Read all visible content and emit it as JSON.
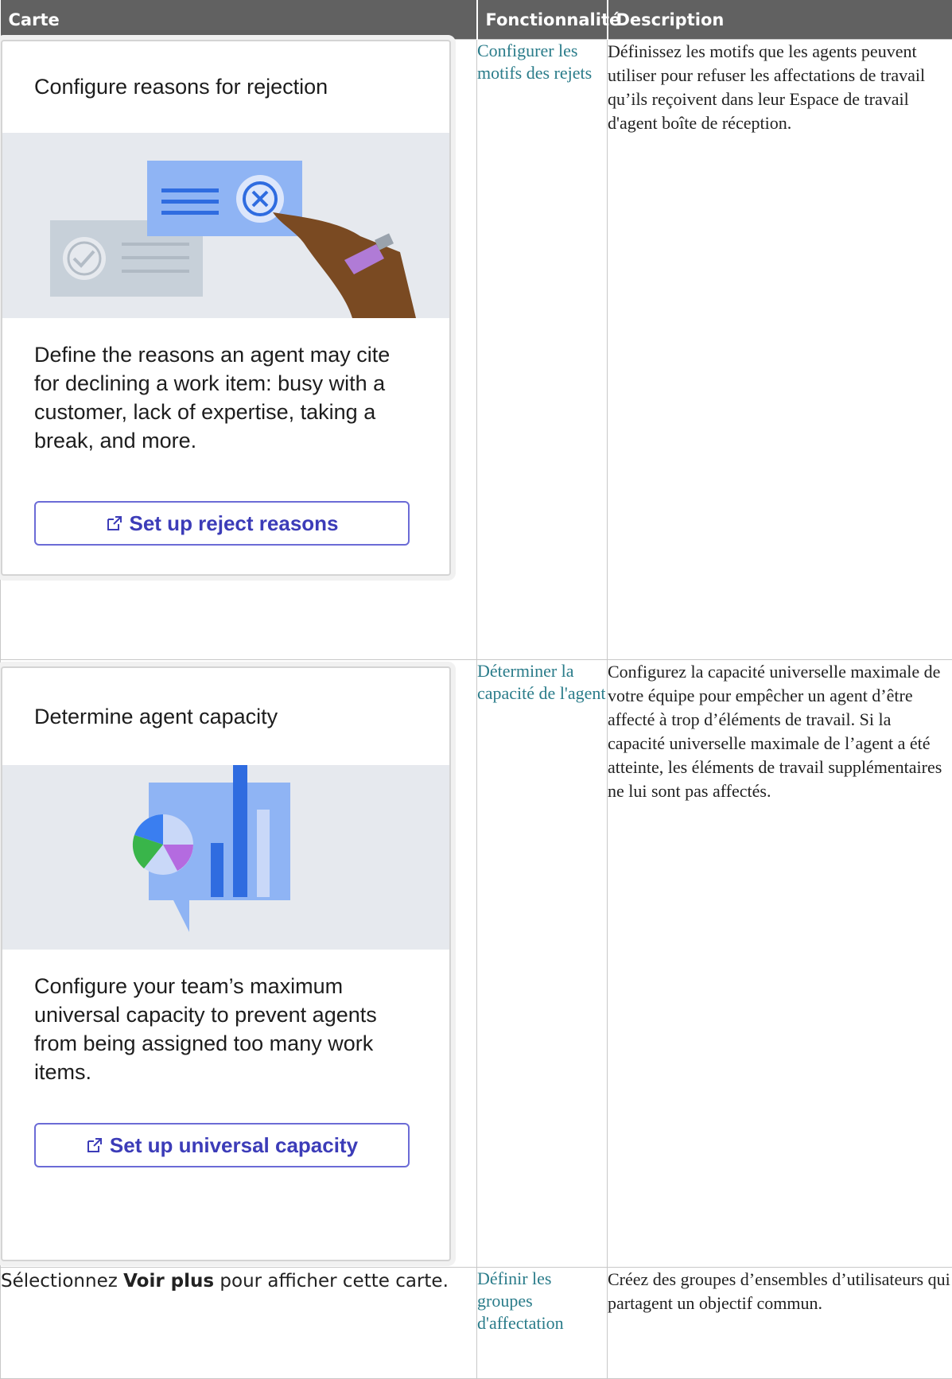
{
  "table": {
    "headers": [
      "Carte",
      "Fonctionnalité",
      "Description"
    ]
  },
  "rows": [
    {
      "card": {
        "title": "Configure reasons for rejection",
        "body": "Define the reasons an agent may cite for declining a work item: busy with a customer, lack of expertise, taking a break, and more.",
        "button_label": "Set up reject reasons",
        "illustration_icon": "reject-hand-illustration"
      },
      "feature": "Configurer les motifs des rejets",
      "description": "Définissez les motifs que les agents peuvent utiliser pour refuser les affectations de travail qu’ils reçoivent dans leur Espace de travail d'agent boîte de réception."
    },
    {
      "card": {
        "title": "Determine agent capacity",
        "body": "Configure your team’s maximum universal capacity to prevent agents from being assigned too many work items.",
        "button_label": "Set up universal capacity",
        "illustration_icon": "capacity-chart-illustration"
      },
      "feature": "Déterminer la capacité de l'agent",
      "description": "Configurez la capacité universelle maximale de votre équipe pour empêcher un agent d’être affecté à trop d’éléments de travail. Si la capacité universelle maximale de l’agent a été atteinte, les éléments de travail supplémentaires ne lui sont pas affectés."
    },
    {
      "note": {
        "prefix": "Sélectionnez ",
        "bold": "Voir plus",
        "suffix": " pour afficher cette carte."
      },
      "feature": "Définir les groupes d'affectation",
      "description": "Créez des groupes d’ensembles d’utilisateurs qui partagent un objectif commun."
    }
  ],
  "colors": {
    "header_bg": "#616161",
    "link": "#2a7c8a",
    "button": "#3c3cb8",
    "illustration_bg": "#e6e9ee"
  }
}
